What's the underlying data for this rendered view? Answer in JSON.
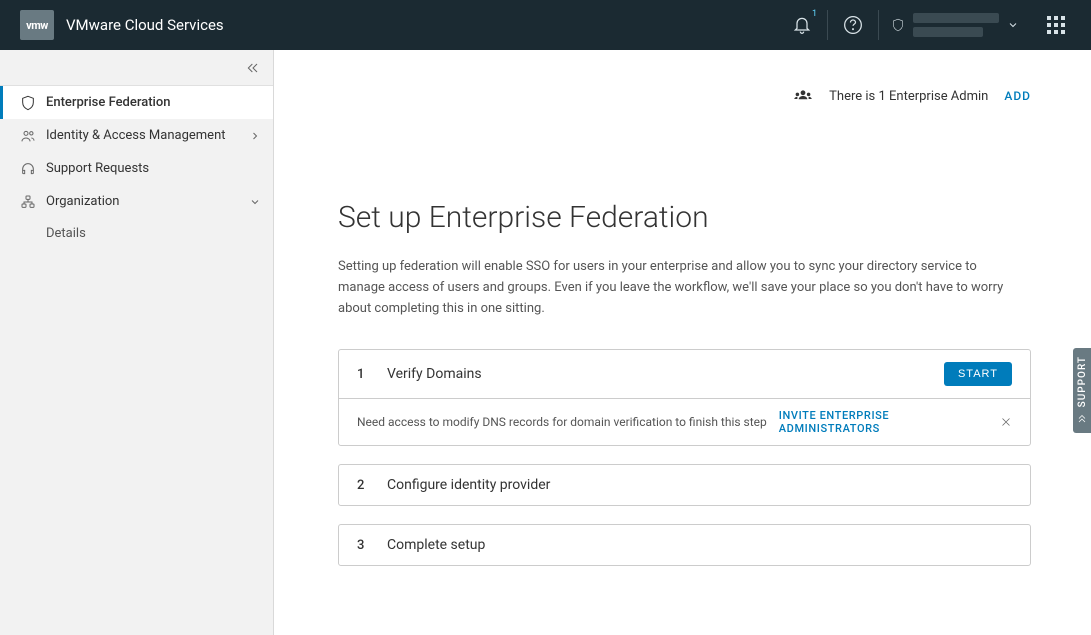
{
  "header": {
    "logo_text": "vmw",
    "title": "VMware Cloud Services",
    "notification_count": "1"
  },
  "sidebar": {
    "items": [
      {
        "label": "Enterprise Federation"
      },
      {
        "label": "Identity & Access Management"
      },
      {
        "label": "Support Requests"
      },
      {
        "label": "Organization"
      }
    ],
    "org_sub": "Details"
  },
  "topbar": {
    "admin_count_text": "There is 1 Enterprise Admin",
    "add_label": "ADD"
  },
  "main": {
    "title": "Set up Enterprise Federation",
    "description": "Setting up federation will enable SSO for users in your enterprise and allow you to sync your directory service to manage access of users and groups. Even if you leave the workflow, we'll save your place so you don't have to worry about completing this in one sitting."
  },
  "steps": [
    {
      "num": "1",
      "title": "Verify Domains",
      "button": "START",
      "notice": "Need access to modify DNS records for domain verification to finish this step",
      "invite": "INVITE ENTERPRISE ADMINISTRATORS"
    },
    {
      "num": "2",
      "title": "Configure identity provider"
    },
    {
      "num": "3",
      "title": "Complete setup"
    }
  ],
  "support": {
    "label": "SUPPORT"
  }
}
